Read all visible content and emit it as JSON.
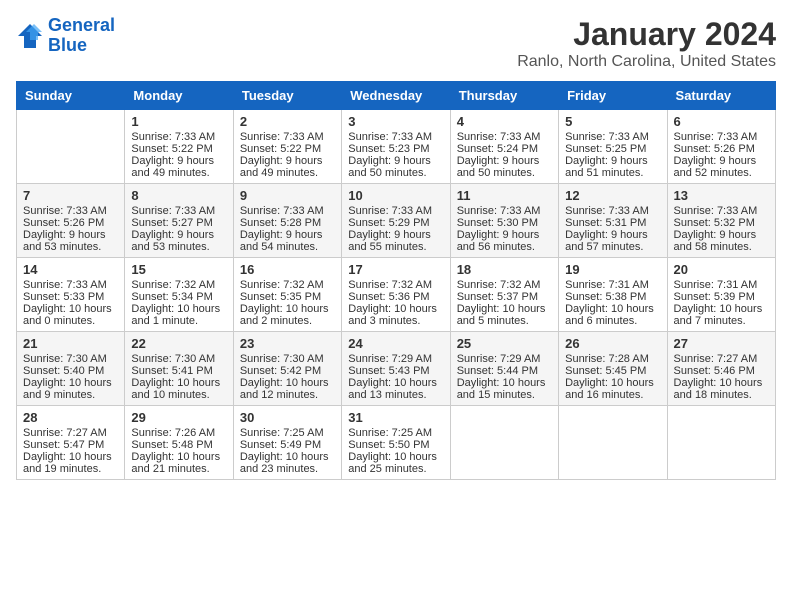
{
  "header": {
    "logo_line1": "General",
    "logo_line2": "Blue",
    "title": "January 2024",
    "subtitle": "Ranlo, North Carolina, United States"
  },
  "calendar": {
    "weekdays": [
      "Sunday",
      "Monday",
      "Tuesday",
      "Wednesday",
      "Thursday",
      "Friday",
      "Saturday"
    ],
    "weeks": [
      [
        {
          "day": "",
          "sunrise": "",
          "sunset": "",
          "daylight": ""
        },
        {
          "day": "1",
          "sunrise": "Sunrise: 7:33 AM",
          "sunset": "Sunset: 5:22 PM",
          "daylight": "Daylight: 9 hours and 49 minutes."
        },
        {
          "day": "2",
          "sunrise": "Sunrise: 7:33 AM",
          "sunset": "Sunset: 5:22 PM",
          "daylight": "Daylight: 9 hours and 49 minutes."
        },
        {
          "day": "3",
          "sunrise": "Sunrise: 7:33 AM",
          "sunset": "Sunset: 5:23 PM",
          "daylight": "Daylight: 9 hours and 50 minutes."
        },
        {
          "day": "4",
          "sunrise": "Sunrise: 7:33 AM",
          "sunset": "Sunset: 5:24 PM",
          "daylight": "Daylight: 9 hours and 50 minutes."
        },
        {
          "day": "5",
          "sunrise": "Sunrise: 7:33 AM",
          "sunset": "Sunset: 5:25 PM",
          "daylight": "Daylight: 9 hours and 51 minutes."
        },
        {
          "day": "6",
          "sunrise": "Sunrise: 7:33 AM",
          "sunset": "Sunset: 5:26 PM",
          "daylight": "Daylight: 9 hours and 52 minutes."
        }
      ],
      [
        {
          "day": "7",
          "sunrise": "Sunrise: 7:33 AM",
          "sunset": "Sunset: 5:26 PM",
          "daylight": "Daylight: 9 hours and 53 minutes."
        },
        {
          "day": "8",
          "sunrise": "Sunrise: 7:33 AM",
          "sunset": "Sunset: 5:27 PM",
          "daylight": "Daylight: 9 hours and 53 minutes."
        },
        {
          "day": "9",
          "sunrise": "Sunrise: 7:33 AM",
          "sunset": "Sunset: 5:28 PM",
          "daylight": "Daylight: 9 hours and 54 minutes."
        },
        {
          "day": "10",
          "sunrise": "Sunrise: 7:33 AM",
          "sunset": "Sunset: 5:29 PM",
          "daylight": "Daylight: 9 hours and 55 minutes."
        },
        {
          "day": "11",
          "sunrise": "Sunrise: 7:33 AM",
          "sunset": "Sunset: 5:30 PM",
          "daylight": "Daylight: 9 hours and 56 minutes."
        },
        {
          "day": "12",
          "sunrise": "Sunrise: 7:33 AM",
          "sunset": "Sunset: 5:31 PM",
          "daylight": "Daylight: 9 hours and 57 minutes."
        },
        {
          "day": "13",
          "sunrise": "Sunrise: 7:33 AM",
          "sunset": "Sunset: 5:32 PM",
          "daylight": "Daylight: 9 hours and 58 minutes."
        }
      ],
      [
        {
          "day": "14",
          "sunrise": "Sunrise: 7:33 AM",
          "sunset": "Sunset: 5:33 PM",
          "daylight": "Daylight: 10 hours and 0 minutes."
        },
        {
          "day": "15",
          "sunrise": "Sunrise: 7:32 AM",
          "sunset": "Sunset: 5:34 PM",
          "daylight": "Daylight: 10 hours and 1 minute."
        },
        {
          "day": "16",
          "sunrise": "Sunrise: 7:32 AM",
          "sunset": "Sunset: 5:35 PM",
          "daylight": "Daylight: 10 hours and 2 minutes."
        },
        {
          "day": "17",
          "sunrise": "Sunrise: 7:32 AM",
          "sunset": "Sunset: 5:36 PM",
          "daylight": "Daylight: 10 hours and 3 minutes."
        },
        {
          "day": "18",
          "sunrise": "Sunrise: 7:32 AM",
          "sunset": "Sunset: 5:37 PM",
          "daylight": "Daylight: 10 hours and 5 minutes."
        },
        {
          "day": "19",
          "sunrise": "Sunrise: 7:31 AM",
          "sunset": "Sunset: 5:38 PM",
          "daylight": "Daylight: 10 hours and 6 minutes."
        },
        {
          "day": "20",
          "sunrise": "Sunrise: 7:31 AM",
          "sunset": "Sunset: 5:39 PM",
          "daylight": "Daylight: 10 hours and 7 minutes."
        }
      ],
      [
        {
          "day": "21",
          "sunrise": "Sunrise: 7:30 AM",
          "sunset": "Sunset: 5:40 PM",
          "daylight": "Daylight: 10 hours and 9 minutes."
        },
        {
          "day": "22",
          "sunrise": "Sunrise: 7:30 AM",
          "sunset": "Sunset: 5:41 PM",
          "daylight": "Daylight: 10 hours and 10 minutes."
        },
        {
          "day": "23",
          "sunrise": "Sunrise: 7:30 AM",
          "sunset": "Sunset: 5:42 PM",
          "daylight": "Daylight: 10 hours and 12 minutes."
        },
        {
          "day": "24",
          "sunrise": "Sunrise: 7:29 AM",
          "sunset": "Sunset: 5:43 PM",
          "daylight": "Daylight: 10 hours and 13 minutes."
        },
        {
          "day": "25",
          "sunrise": "Sunrise: 7:29 AM",
          "sunset": "Sunset: 5:44 PM",
          "daylight": "Daylight: 10 hours and 15 minutes."
        },
        {
          "day": "26",
          "sunrise": "Sunrise: 7:28 AM",
          "sunset": "Sunset: 5:45 PM",
          "daylight": "Daylight: 10 hours and 16 minutes."
        },
        {
          "day": "27",
          "sunrise": "Sunrise: 7:27 AM",
          "sunset": "Sunset: 5:46 PM",
          "daylight": "Daylight: 10 hours and 18 minutes."
        }
      ],
      [
        {
          "day": "28",
          "sunrise": "Sunrise: 7:27 AM",
          "sunset": "Sunset: 5:47 PM",
          "daylight": "Daylight: 10 hours and 19 minutes."
        },
        {
          "day": "29",
          "sunrise": "Sunrise: 7:26 AM",
          "sunset": "Sunset: 5:48 PM",
          "daylight": "Daylight: 10 hours and 21 minutes."
        },
        {
          "day": "30",
          "sunrise": "Sunrise: 7:25 AM",
          "sunset": "Sunset: 5:49 PM",
          "daylight": "Daylight: 10 hours and 23 minutes."
        },
        {
          "day": "31",
          "sunrise": "Sunrise: 7:25 AM",
          "sunset": "Sunset: 5:50 PM",
          "daylight": "Daylight: 10 hours and 25 minutes."
        },
        {
          "day": "",
          "sunrise": "",
          "sunset": "",
          "daylight": ""
        },
        {
          "day": "",
          "sunrise": "",
          "sunset": "",
          "daylight": ""
        },
        {
          "day": "",
          "sunrise": "",
          "sunset": "",
          "daylight": ""
        }
      ]
    ]
  }
}
